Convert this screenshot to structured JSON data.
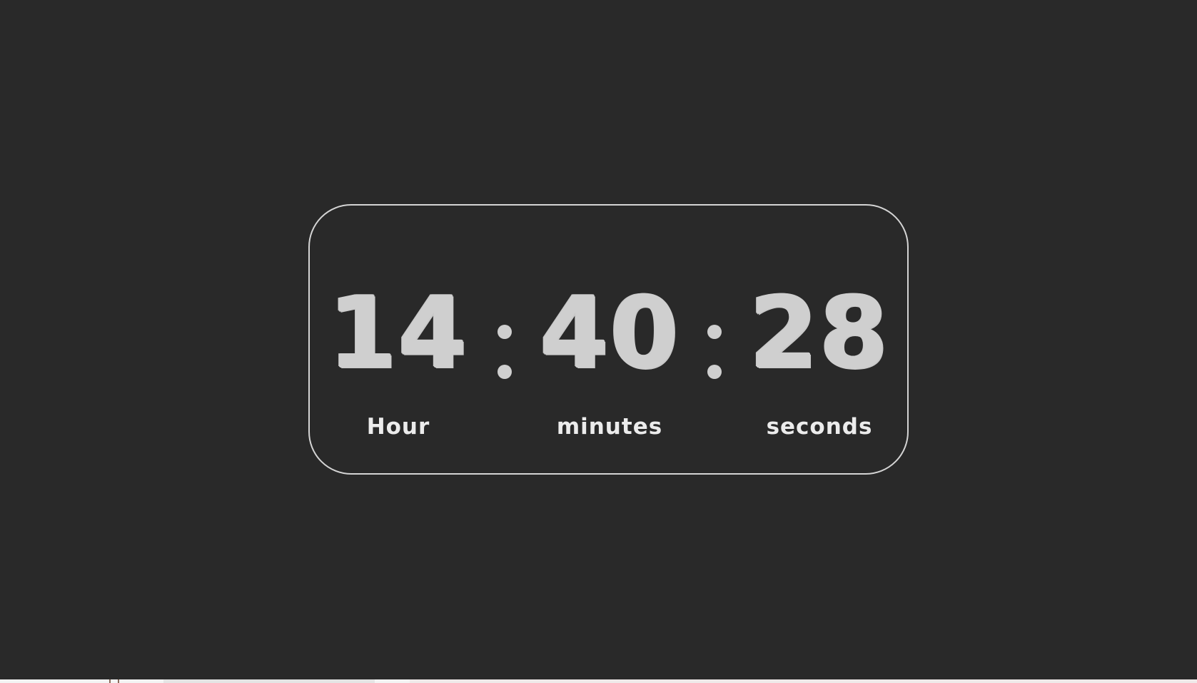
{
  "clock": {
    "hours": "14",
    "minutes": "40",
    "seconds": "28",
    "separator": ":",
    "labels": {
      "hours": "Hour",
      "minutes": "minutes",
      "seconds": "seconds"
    }
  },
  "colors": {
    "background": "#292929",
    "digits": "#cfcfcf",
    "labels": "#ececec",
    "border": "#d4d4d4"
  }
}
